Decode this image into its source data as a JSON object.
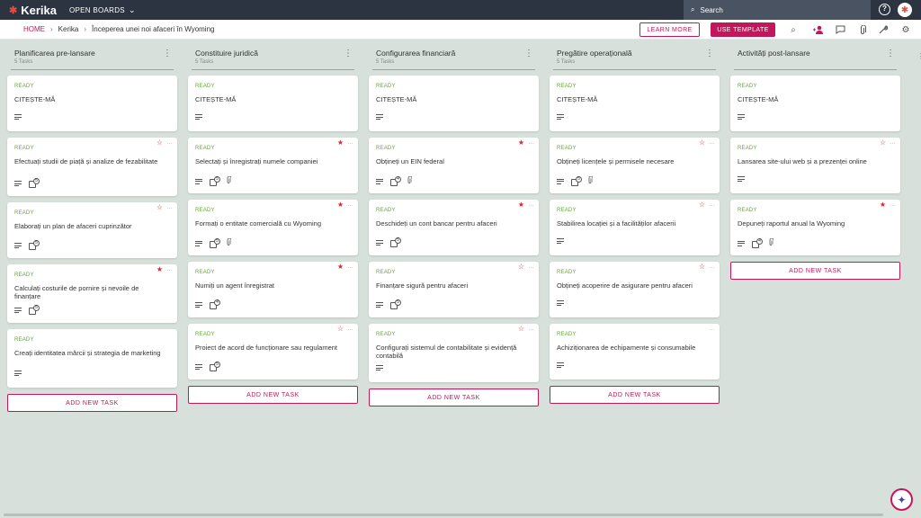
{
  "app": {
    "logo_text": "Kerika",
    "open_boards_label": "OPEN BOARDS"
  },
  "search": {
    "label": "Search"
  },
  "breadcrumb": {
    "home": "HOME",
    "org": "Kerika",
    "board": "Începerea unei noi afaceri în Wyoming"
  },
  "actions": {
    "learn_more": "LEARN MORE",
    "use_template": "USE TEMPLATE"
  },
  "icons": {
    "logo": "kerika-logo-icon",
    "search": "search-icon",
    "help": "help-icon",
    "avatar": "user-avatar",
    "board_search": "search-icon",
    "add_member": "add-person-icon",
    "chat": "chat-icon",
    "attachments": "paperclip-icon",
    "tools": "wrench-icon",
    "settings": "gear-icon",
    "assistant": "sparkle-icon"
  },
  "colors": {
    "accent": "#c2185b",
    "nav": "#2c3441",
    "ready": "#6aa342",
    "star": "#e0232e",
    "board_bg": "#d7e0db"
  },
  "add_task_label": "ADD NEW TASK",
  "columns": [
    {
      "title": "Planificarea pre-lansare",
      "count": "5 Tasks",
      "cards": [
        {
          "status": "READY",
          "title": "CITEȘTE-MĂ",
          "star": null,
          "checklist": null,
          "attachment": false
        },
        {
          "status": "READY",
          "title": "Efectuați studii de piață și analize de fezabilitate",
          "star": "outline",
          "checklist": "5",
          "attachment": false
        },
        {
          "status": "READY",
          "title": "Elaborați un plan de afaceri cuprinzător",
          "star": "outline",
          "checklist": "5",
          "attachment": false
        },
        {
          "status": "READY",
          "title": "Calculați costurile de pornire și nevoile de finanțare",
          "star": "filled",
          "checklist": "5",
          "attachment": false
        },
        {
          "status": "READY",
          "title": "Creați identitatea mărcii și strategia de marketing",
          "star": null,
          "checklist": null,
          "attachment": false
        }
      ]
    },
    {
      "title": "Constituire juridică",
      "count": "5 Tasks",
      "cards": [
        {
          "status": "READY",
          "title": "CITEȘTE-MĂ",
          "star": null,
          "checklist": null,
          "attachment": false
        },
        {
          "status": "READY",
          "title": "Selectați și înregistrați numele companiei",
          "star": "filled",
          "checklist": "5",
          "attachment": true
        },
        {
          "status": "READY",
          "title": "Formați o entitate comercială cu Wyoming",
          "star": "filled",
          "checklist": "5",
          "attachment": true
        },
        {
          "status": "READY",
          "title": "Numiți un agent înregistrat",
          "star": "filled",
          "checklist": "4",
          "attachment": false
        },
        {
          "status": "READY",
          "title": "Proiect de acord de funcționare sau regulament",
          "star": "outline",
          "checklist": "5",
          "attachment": false
        }
      ]
    },
    {
      "title": "Configurarea financiară",
      "count": "5 Tasks",
      "cards": [
        {
          "status": "READY",
          "title": "CITEȘTE-MĂ",
          "star": null,
          "checklist": null,
          "attachment": false
        },
        {
          "status": "READY",
          "title": "Obțineți un EIN federal",
          "star": "filled",
          "checklist": "4",
          "attachment": true
        },
        {
          "status": "READY",
          "title": "Deschideți un cont bancar pentru afaceri",
          "star": "filled",
          "checklist": "5",
          "attachment": false
        },
        {
          "status": "READY",
          "title": "Finanțare sigură pentru afaceri",
          "star": "outline",
          "checklist": "5",
          "attachment": false
        },
        {
          "status": "READY",
          "title": "Configurați sistemul de contabilitate și evidență contabilă",
          "star": "outline",
          "checklist": null,
          "attachment": false
        }
      ]
    },
    {
      "title": "Pregătire operațională",
      "count": "5 Tasks",
      "cards": [
        {
          "status": "READY",
          "title": "CITEȘTE-MĂ",
          "star": null,
          "checklist": null,
          "attachment": false
        },
        {
          "status": "READY",
          "title": "Obțineți licențele și permisele necesare",
          "star": "outline",
          "checklist": "5",
          "attachment": true
        },
        {
          "status": "READY",
          "title": "Stabilirea locației și a facilităților afacerii",
          "star": "outline",
          "checklist": null,
          "attachment": false
        },
        {
          "status": "READY",
          "title": "Obțineți acoperire de asigurare pentru afaceri",
          "star": "outline",
          "checklist": null,
          "attachment": false
        },
        {
          "status": "READY",
          "title": "Achiziționarea de echipamente și consumabile",
          "star": "none",
          "checklist": null,
          "attachment": false
        }
      ]
    },
    {
      "title": "Activități post-lansare",
      "count": "",
      "cards": [
        {
          "status": "READY",
          "title": "CITEȘTE-MĂ",
          "star": null,
          "checklist": null,
          "attachment": false
        },
        {
          "status": "READY",
          "title": "Lansarea site-ului web și a prezenței online",
          "star": "outline",
          "checklist": null,
          "attachment": false
        },
        {
          "status": "READY",
          "title": "Depuneți raportul anual la Wyoming",
          "star": "filled",
          "checklist": "4",
          "attachment": true
        }
      ]
    }
  ]
}
